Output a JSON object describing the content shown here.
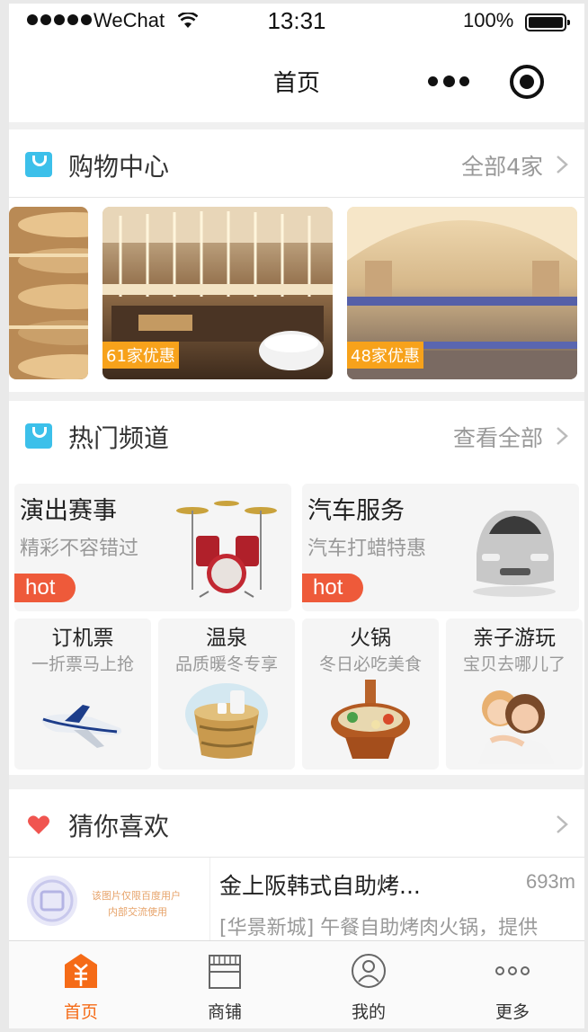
{
  "status_bar": {
    "carrier": "WeChat",
    "time": "13:31",
    "battery": "100%"
  },
  "nav": {
    "title": "首页"
  },
  "shopping": {
    "title": "购物中心",
    "more": "全部4家",
    "malls": [
      {
        "badge": ""
      },
      {
        "badge": "61家优惠"
      },
      {
        "badge": "48家优惠"
      }
    ]
  },
  "hot_channels": {
    "title": "热门频道",
    "more": "查看全部",
    "big": [
      {
        "title": "演出赛事",
        "subtitle": "精彩不容错过",
        "tag": "hot"
      },
      {
        "title": "汽车服务",
        "subtitle": "汽车打蜡特惠",
        "tag": "hot"
      }
    ],
    "small": [
      {
        "title": "订机票",
        "subtitle": "一折票马上抢"
      },
      {
        "title": "温泉",
        "subtitle": "品质暖冬专享"
      },
      {
        "title": "火锅",
        "subtitle": "冬日必吃美食"
      },
      {
        "title": "亲子游玩",
        "subtitle": "宝贝去哪儿了"
      }
    ]
  },
  "guess": {
    "title": "猜你喜欢",
    "items": [
      {
        "thumb_note_1": "该图片仅限百度用户",
        "thumb_note_2": "内部交流使用",
        "name": "金上阪韩式自助烤...",
        "distance": "693m",
        "desc": "[华景新城] 午餐自助烤肉火锅，提供"
      }
    ]
  },
  "tabs": [
    {
      "label": "首页",
      "icon": "home-icon",
      "active": true
    },
    {
      "label": "商铺",
      "icon": "shop-icon",
      "active": false
    },
    {
      "label": "我的",
      "icon": "user-icon",
      "active": false
    },
    {
      "label": "更多",
      "icon": "more-icon",
      "active": false
    }
  ],
  "colors": {
    "accent": "#f56b17",
    "hot": "#ee5a3a",
    "badge": "#f7a21b",
    "section_icon": "#3cc0ea"
  }
}
